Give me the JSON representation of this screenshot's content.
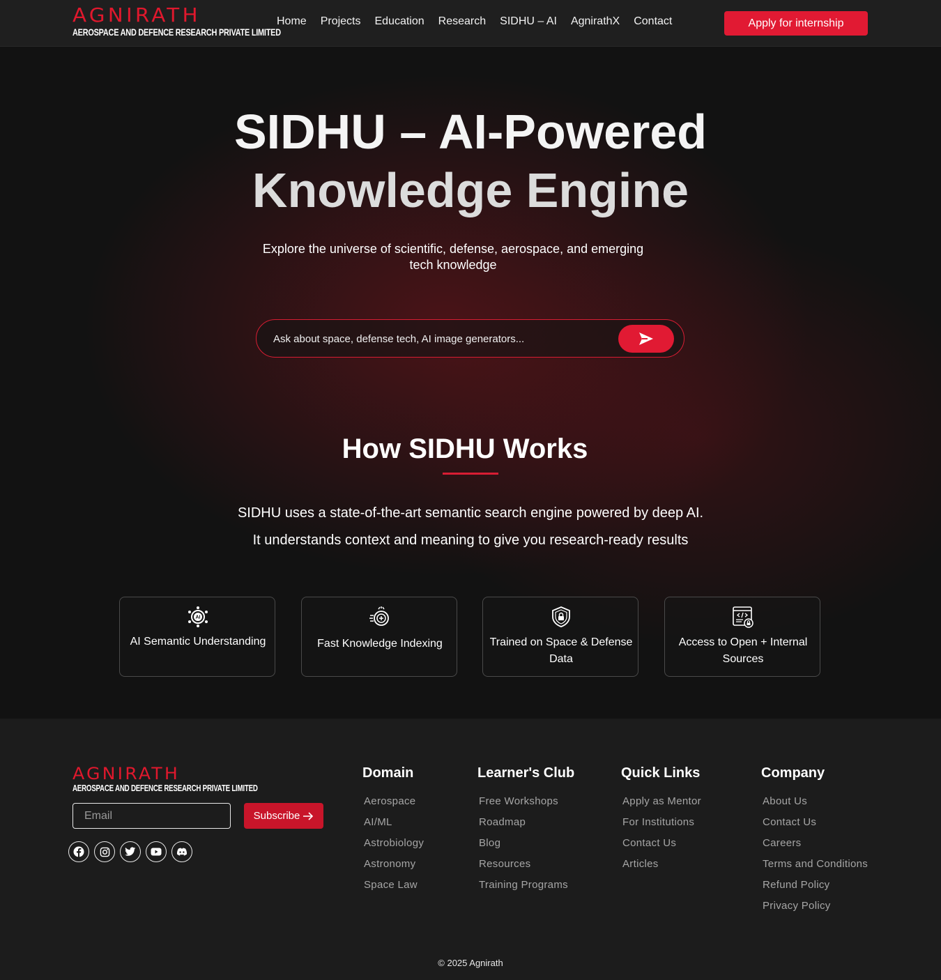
{
  "brand": {
    "name": "AGNIRATH",
    "tagline": "AEROSPACE AND DEFENCE RESEARCH PRIVATE LIMITED"
  },
  "nav": {
    "links": [
      "Home",
      "Projects",
      "Education",
      "Research",
      "SIDHU – AI",
      "AgnirathX",
      "Contact"
    ],
    "cta": "Apply for internship"
  },
  "hero": {
    "title_line1": "SIDHU – AI-Powered",
    "title_line2": "Knowledge Engine",
    "subtitle": "Explore the universe of scientific, defense, aerospace, and emerging tech knowledge",
    "search_placeholder": "Ask about space, defense tech, AI image generators..."
  },
  "how": {
    "title": "How SIDHU Works",
    "desc_line1": "SIDHU uses a state-of-the-art semantic search engine powered by deep AI.",
    "desc_line2": "It understands context and meaning to give you research-ready results",
    "cards": [
      {
        "icon": "ai-brain-icon",
        "text": "AI Semantic Understanding"
      },
      {
        "icon": "fast-indexing-icon",
        "text": "Fast Knowledge Indexing"
      },
      {
        "icon": "shield-lock-icon",
        "text": "Trained on Space & Defense Data"
      },
      {
        "icon": "code-document-icon",
        "text": "Access to Open + Internal Sources"
      }
    ]
  },
  "footer": {
    "email_placeholder": "Email",
    "subscribe": "Subscribe",
    "socials": [
      "facebook-icon",
      "instagram-icon",
      "twitter-icon",
      "youtube-icon",
      "discord-icon"
    ],
    "columns": [
      {
        "title": "Domain",
        "links": [
          "Aerospace",
          "AI/ML",
          "Astrobiology",
          "Astronomy",
          "Space Law"
        ]
      },
      {
        "title": "Learner's Club",
        "links": [
          "Free Workshops",
          "Roadmap",
          "Blog",
          "Resources",
          "Training Programs"
        ]
      },
      {
        "title": "Quick Links",
        "links": [
          "Apply as Mentor",
          "For Institutions",
          "Contact Us",
          "Articles"
        ]
      },
      {
        "title": "Company",
        "links": [
          "About Us",
          "Contact Us",
          "Careers",
          "Terms and Conditions",
          "Refund Policy",
          "Privacy Policy"
        ]
      }
    ],
    "copyright": "© 2025 Agnirath"
  },
  "colors": {
    "accent": "#e11a33",
    "background": "#121212",
    "footer_bg": "#1c1c1c"
  }
}
